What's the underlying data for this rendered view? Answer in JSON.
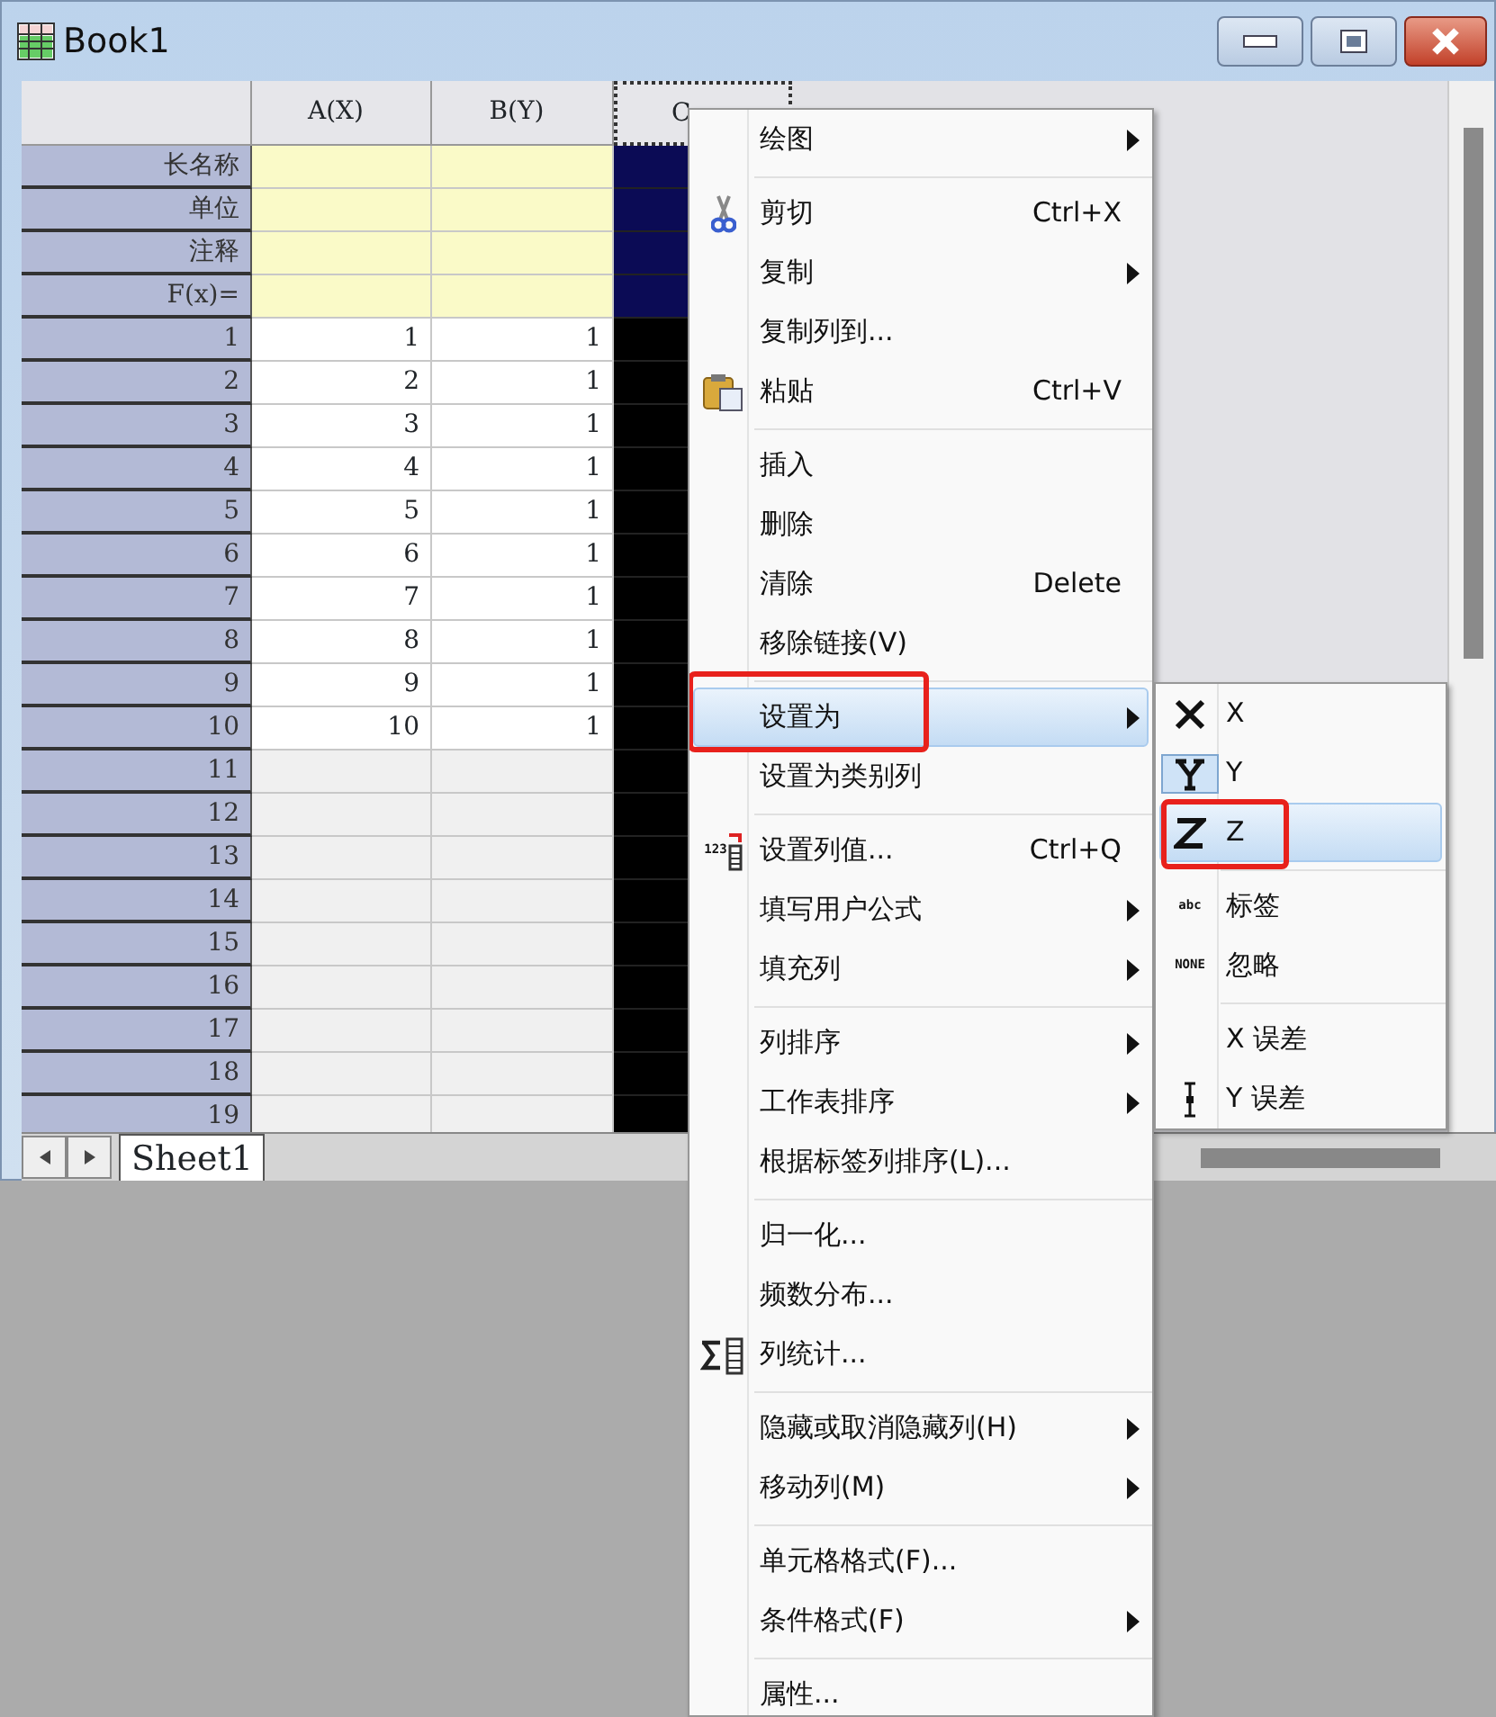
{
  "window": {
    "title": "Book1"
  },
  "columns": [
    {
      "label": "A(X)",
      "selected": false
    },
    {
      "label": "B(Y)",
      "selected": false
    },
    {
      "label": "C",
      "selected": true
    }
  ],
  "label_rows": [
    {
      "label": "长名称"
    },
    {
      "label": "单位"
    },
    {
      "label": "注释"
    },
    {
      "label": "F(x)="
    }
  ],
  "rows": [
    {
      "label": "1",
      "cells": [
        "1",
        "1"
      ]
    },
    {
      "label": "2",
      "cells": [
        "2",
        "1"
      ]
    },
    {
      "label": "3",
      "cells": [
        "3",
        "1"
      ]
    },
    {
      "label": "4",
      "cells": [
        "4",
        "1"
      ]
    },
    {
      "label": "5",
      "cells": [
        "5",
        "1"
      ]
    },
    {
      "label": "6",
      "cells": [
        "6",
        "1"
      ]
    },
    {
      "label": "7",
      "cells": [
        "7",
        "1"
      ]
    },
    {
      "label": "8",
      "cells": [
        "8",
        "1"
      ]
    },
    {
      "label": "9",
      "cells": [
        "9",
        "1"
      ]
    },
    {
      "label": "10",
      "cells": [
        "10",
        "1"
      ]
    },
    {
      "label": "11",
      "cells": []
    },
    {
      "label": "12",
      "cells": []
    },
    {
      "label": "13",
      "cells": []
    },
    {
      "label": "14",
      "cells": []
    },
    {
      "label": "15",
      "cells": []
    },
    {
      "label": "16",
      "cells": []
    },
    {
      "label": "17",
      "cells": []
    },
    {
      "label": "18",
      "cells": []
    },
    {
      "label": "19",
      "cells": []
    }
  ],
  "sheet_tabs": [
    {
      "label": "Sheet1",
      "selected": true
    }
  ],
  "context_menu": {
    "items": [
      {
        "kind": "plain",
        "label": "绘图",
        "has_submenu": true,
        "selected": false,
        "marked": false
      },
      {
        "kind": "separator"
      },
      {
        "kind": "scissors",
        "label": "剪切",
        "shortcut": "Ctrl+X",
        "has_submenu": false,
        "selected": false,
        "marked": false
      },
      {
        "kind": "plain",
        "label": "复制",
        "has_submenu": true,
        "selected": false,
        "marked": false
      },
      {
        "kind": "plain",
        "label": "复制列到...",
        "has_submenu": false,
        "selected": false,
        "marked": false
      },
      {
        "kind": "paste",
        "label": "粘贴",
        "shortcut": "Ctrl+V",
        "has_submenu": false,
        "selected": false,
        "marked": false
      },
      {
        "kind": "separator"
      },
      {
        "kind": "plain",
        "label": "插入",
        "has_submenu": false,
        "selected": false,
        "marked": false
      },
      {
        "kind": "plain",
        "label": "删除",
        "has_submenu": false,
        "selected": false,
        "marked": false
      },
      {
        "kind": "plain",
        "label": "清除",
        "shortcut": "Delete",
        "has_submenu": false,
        "selected": false,
        "marked": false
      },
      {
        "kind": "plain",
        "label": "移除链接(V)",
        "has_submenu": false,
        "selected": false,
        "marked": false
      },
      {
        "kind": "separator"
      },
      {
        "kind": "plain",
        "label": "设置为",
        "has_submenu": true,
        "selected": true,
        "marked": true
      },
      {
        "kind": "plain",
        "label": "设置为类别列",
        "has_submenu": false,
        "selected": false,
        "marked": false
      },
      {
        "kind": "separator"
      },
      {
        "kind": "values",
        "label": "设置列值...",
        "shortcut": "Ctrl+Q",
        "icon_text": "123",
        "has_submenu": false,
        "selected": false,
        "marked": false
      },
      {
        "kind": "plain",
        "label": "填写用户公式",
        "has_submenu": true,
        "selected": false,
        "marked": false
      },
      {
        "kind": "plain",
        "label": "填充列",
        "has_submenu": true,
        "selected": false,
        "marked": false
      },
      {
        "kind": "separator"
      },
      {
        "kind": "plain",
        "label": "列排序",
        "has_submenu": true,
        "selected": false,
        "marked": false
      },
      {
        "kind": "plain",
        "label": "工作表排序",
        "has_submenu": true,
        "selected": false,
        "marked": false
      },
      {
        "kind": "plain",
        "label": "根据标签列排序(L)...",
        "has_submenu": false,
        "selected": false,
        "marked": false
      },
      {
        "kind": "separator"
      },
      {
        "kind": "plain",
        "label": "归一化...",
        "has_submenu": false,
        "selected": false,
        "marked": false
      },
      {
        "kind": "plain",
        "label": "频数分布...",
        "has_submenu": false,
        "selected": false,
        "marked": false
      },
      {
        "kind": "statistics",
        "label": "列统计...",
        "has_submenu": false,
        "selected": false,
        "marked": false
      },
      {
        "kind": "separator"
      },
      {
        "kind": "plain",
        "label": "隐藏或取消隐藏列(H)",
        "has_submenu": true,
        "selected": false,
        "marked": false
      },
      {
        "kind": "plain",
        "label": "移动列(M)",
        "has_submenu": true,
        "selected": false,
        "marked": false
      },
      {
        "kind": "separator"
      },
      {
        "kind": "plain",
        "label": "单元格格式(F)...",
        "has_submenu": false,
        "selected": false,
        "marked": false
      },
      {
        "kind": "plain",
        "label": "条件格式(F)",
        "has_submenu": true,
        "selected": false,
        "marked": false
      },
      {
        "kind": "separator"
      },
      {
        "kind": "plain",
        "label": "属性...",
        "has_submenu": false,
        "selected": false,
        "marked": false
      }
    ]
  },
  "submenu": {
    "items": [
      {
        "kind": "cross",
        "label": "X",
        "checked": false,
        "selected": false,
        "marked": false
      },
      {
        "kind": "yletter",
        "label": "Y",
        "checked": true,
        "selected": false,
        "marked": false
      },
      {
        "kind": "zletter",
        "label": "Z",
        "checked": false,
        "selected": true,
        "marked": true
      },
      {
        "kind": "separator"
      },
      {
        "kind": "captioned",
        "label": "标签",
        "icon_text": "abc",
        "checked": false,
        "selected": false,
        "marked": false
      },
      {
        "kind": "captioned",
        "label": "忽略",
        "icon_text": "NONE",
        "checked": false,
        "selected": false,
        "marked": false
      },
      {
        "kind": "separator"
      },
      {
        "kind": "plain",
        "label": "X 误差",
        "checked": false,
        "selected": false,
        "marked": false
      },
      {
        "kind": "errorbar",
        "label": "Y 误差",
        "checked": false,
        "selected": false,
        "marked": false
      }
    ]
  }
}
